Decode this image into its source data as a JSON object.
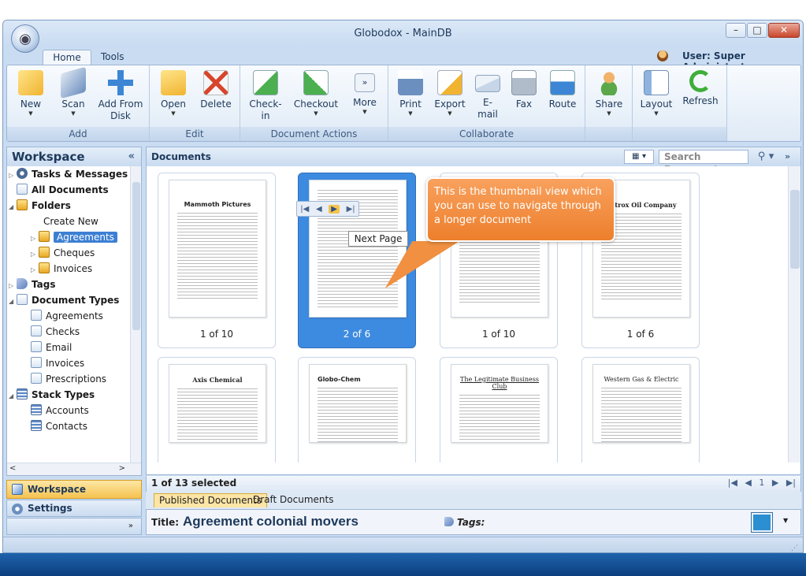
{
  "window": {
    "title": "Globodox - MainDB",
    "minimize": "–",
    "maximize": "□",
    "close": "✕"
  },
  "ribbon_tabs": [
    "Home",
    "Tools"
  ],
  "user": {
    "label": "User: Super Administrator"
  },
  "ribbon": {
    "groups": [
      {
        "label": "Add",
        "buttons": [
          {
            "label": "New",
            "icon": "new-document-icon",
            "color": "#f0b430"
          },
          {
            "label": "Scan",
            "icon": "scanner-icon",
            "color": "#6b8fbf"
          },
          {
            "label": "Add From\nDisk",
            "icon": "plus-icon",
            "color": "#3d86d6"
          }
        ]
      },
      {
        "label": "Edit",
        "buttons": [
          {
            "label": "Open",
            "icon": "folder-open-icon",
            "color": "#f0b430"
          },
          {
            "label": "Delete",
            "icon": "delete-icon",
            "color": "#d8452b"
          }
        ]
      },
      {
        "label": "Document Actions",
        "buttons": [
          {
            "label": "Check-\nin",
            "icon": "check-in-icon",
            "color": "#4caf50"
          },
          {
            "label": "Checkout",
            "icon": "checkout-icon",
            "color": "#4caf50"
          },
          {
            "label": "More",
            "icon": "more-icon",
            "color": "#dfe7f2"
          }
        ]
      },
      {
        "label": "Collaborate",
        "buttons": [
          {
            "label": "Print",
            "icon": "printer-icon",
            "color": "#6b8fbf"
          },
          {
            "label": "Export",
            "icon": "export-icon",
            "color": "#f0b430"
          },
          {
            "label": "E-\nmail",
            "icon": "email-icon",
            "color": "#c7d5e8"
          },
          {
            "label": "Fax",
            "icon": "fax-icon",
            "color": "#b0bcc9"
          },
          {
            "label": "Route",
            "icon": "route-icon",
            "color": "#3d86d6"
          }
        ]
      },
      {
        "label": "",
        "buttons": [
          {
            "label": "Share",
            "icon": "share-icon",
            "color": "#5aa84a"
          }
        ]
      },
      {
        "label": "",
        "buttons": [
          {
            "label": "Layout",
            "icon": "layout-icon",
            "color": "#8fb3df"
          },
          {
            "label": "Refresh",
            "icon": "refresh-icon",
            "color": "#3fae3a"
          }
        ]
      }
    ]
  },
  "workspace": {
    "title": "Workspace",
    "collapse": "«",
    "tree": [
      {
        "label": "Tasks & Messages",
        "bold": true
      },
      {
        "label": "All Documents",
        "bold": true
      },
      {
        "label": "Folders",
        "bold": true
      },
      {
        "label": "Create New",
        "bold": false
      },
      {
        "label": "Agreements",
        "bold": false,
        "selected": true
      },
      {
        "label": "Cheques",
        "bold": false
      },
      {
        "label": "Invoices",
        "bold": false
      },
      {
        "label": "Tags",
        "bold": true
      },
      {
        "label": "Document Types",
        "bold": true
      },
      {
        "label": "Agreements",
        "bold": false
      },
      {
        "label": "Checks",
        "bold": false
      },
      {
        "label": "Email",
        "bold": false
      },
      {
        "label": "Invoices",
        "bold": false
      },
      {
        "label": "Prescriptions",
        "bold": false
      },
      {
        "label": "Stack Types",
        "bold": true
      },
      {
        "label": "Accounts",
        "bold": false
      },
      {
        "label": "Contacts",
        "bold": false
      }
    ],
    "nav": [
      "Workspace",
      "Settings"
    ]
  },
  "documents": {
    "title": "Documents",
    "search_placeholder": "Search Documents",
    "thumbnails": [
      {
        "title": "Mammoth Pictures",
        "count": "1 of 10",
        "selected": false
      },
      {
        "title": "",
        "count": "2 of 6",
        "selected": true
      },
      {
        "title": "",
        "count": "1 of 10",
        "selected": false
      },
      {
        "title": "Petrox Oil Company",
        "count": "1 of 6",
        "selected": false
      },
      {
        "title": "Axis Chemical",
        "count": "",
        "selected": false
      },
      {
        "title": "Globo-Chem",
        "count": "",
        "selected": false
      },
      {
        "title": "The Legitimate Business Club",
        "count": "",
        "selected": false
      },
      {
        "title": "Western Gas & Electric",
        "count": "",
        "selected": false
      }
    ],
    "tooltip": "Next Page",
    "callout": "This is the thumbnail view which you can use to navigate through a longer document",
    "status": "1 of 13 selected",
    "pager": "|◀ ◀   1 ▶ ▶|",
    "tabs": [
      "Published Documents",
      "Draft Documents"
    ],
    "meta": {
      "title_label": "Title:",
      "title_value": "Agreement colonial movers",
      "tags_label": "Tags:"
    }
  }
}
